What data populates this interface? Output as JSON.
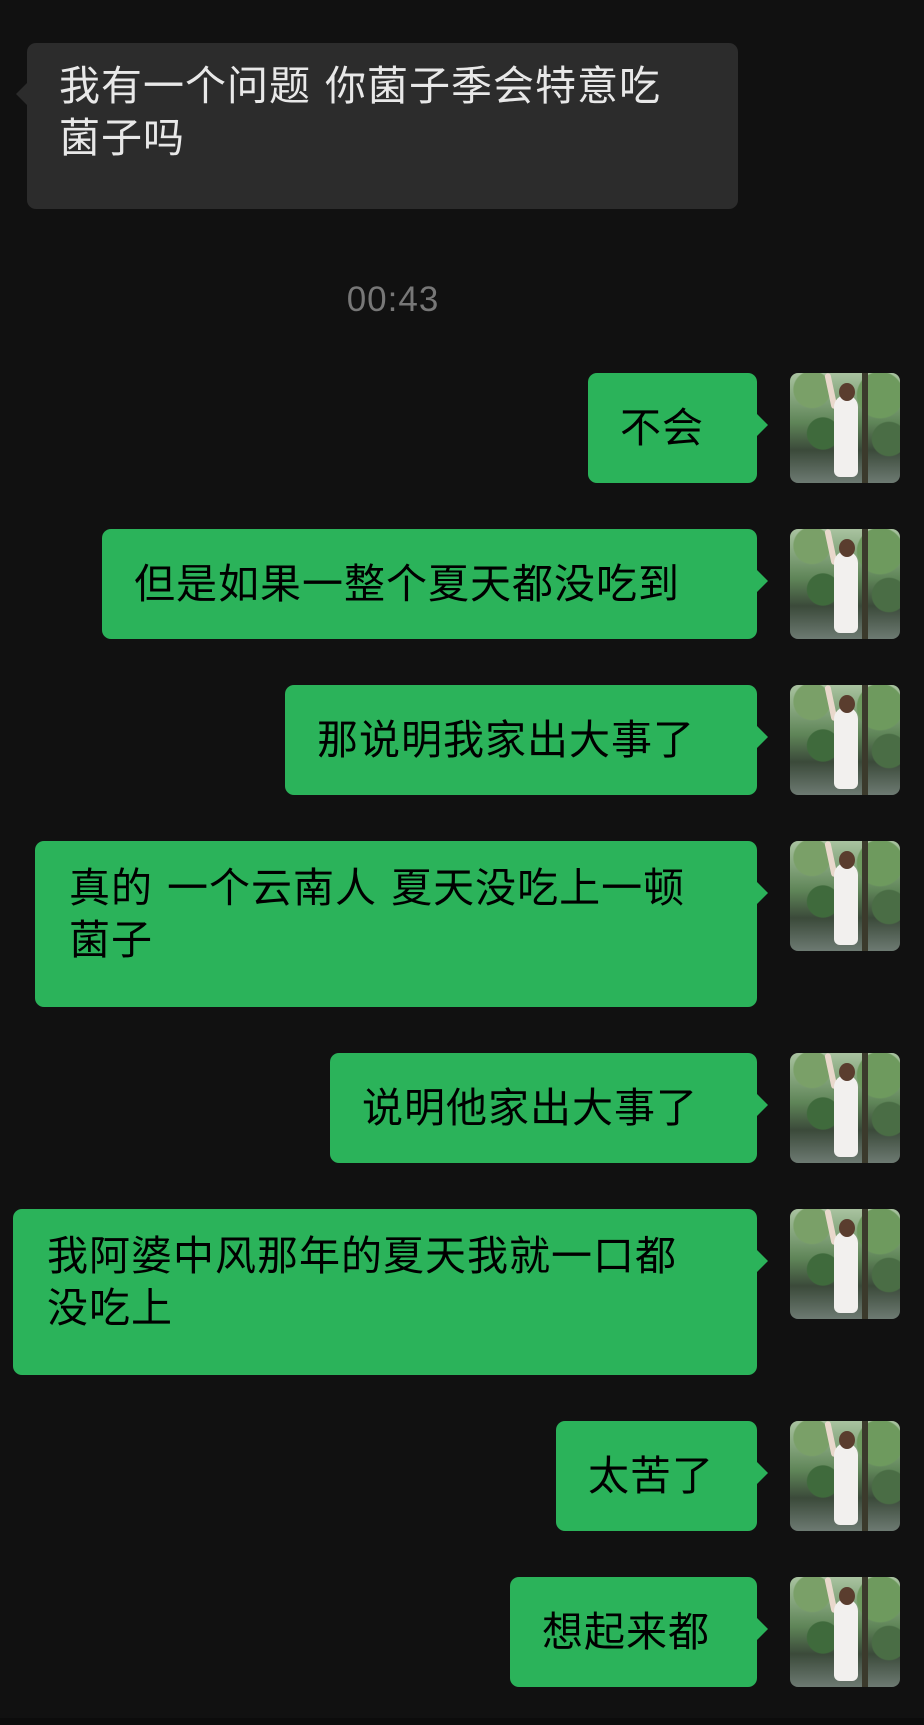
{
  "chat": {
    "incoming": [
      {
        "line1": "我有一个问题 你菌子季会特意吃",
        "line2": "菌子吗"
      }
    ],
    "timestamp": "00:43",
    "outgoing": [
      {
        "text": "不会"
      },
      {
        "text": "但是如果一整个夏天都没吃到"
      },
      {
        "text": "那说明我家出大事了"
      },
      {
        "line1": "真的 一个云南人 夏天没吃上一顿",
        "line2": "菌子"
      },
      {
        "text": "说明他家出大事了"
      },
      {
        "line1": "我阿婆中风那年的夏天我就一口都",
        "line2": "没吃上"
      },
      {
        "text": "太苦了"
      },
      {
        "text": "想起来都"
      }
    ]
  },
  "colors": {
    "background": "#111111",
    "incoming_bubble": "#2c2c2c",
    "outgoing_bubble": "#2bb35a",
    "timestamp": "#777777"
  }
}
